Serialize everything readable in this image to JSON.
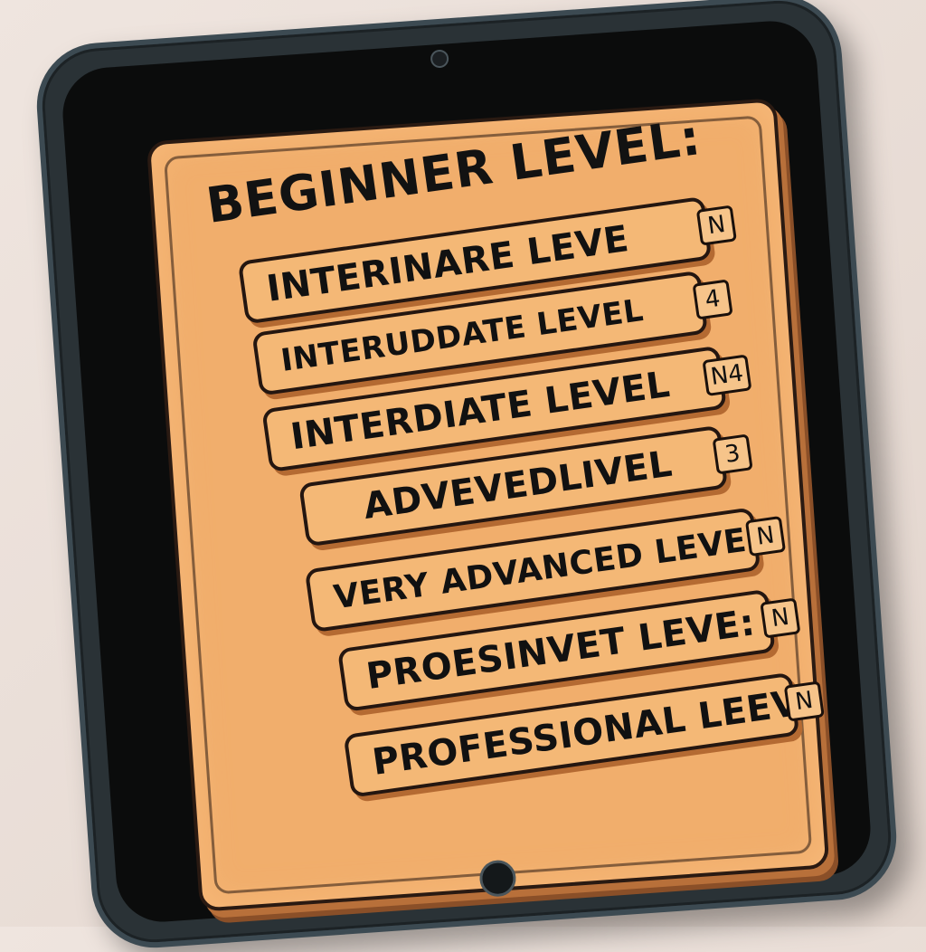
{
  "card": {
    "heading": "BEGINNER LEVEL:"
  },
  "levels": [
    {
      "label": "INTERINARE LEVE",
      "badge": "N"
    },
    {
      "label": "INTERUDDATE LEVEL",
      "badge": "4"
    },
    {
      "label": "INTERDIATE LEVEL",
      "badge": "N4"
    },
    {
      "label": "ADVEVEDLIVEL",
      "badge": "3"
    },
    {
      "label": "VERY ADVANCED LEVEL",
      "badge": "N"
    },
    {
      "label": "PROESINVET LEVE:",
      "badge": "N"
    },
    {
      "label": "PROFESSIONAL LEEV",
      "badge": "N"
    }
  ],
  "colors": {
    "card": "#f1ae6c",
    "tablet_frame": "#2a3236",
    "screen_bezel": "#0b0c0c",
    "ink": "#121212"
  }
}
